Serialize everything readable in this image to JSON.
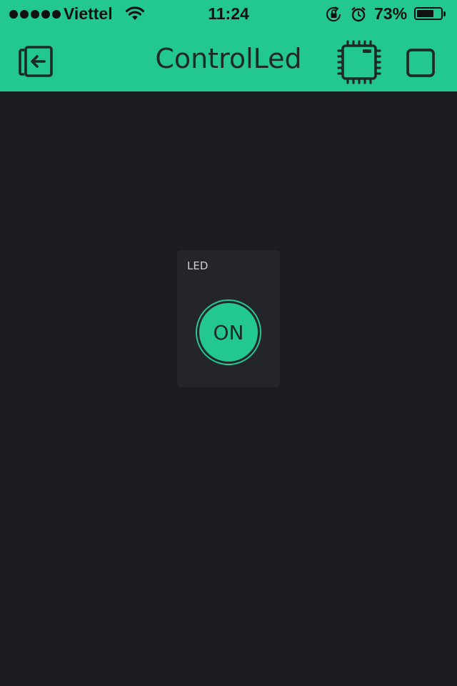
{
  "status_bar": {
    "carrier": "Viettel",
    "time": "11:24",
    "battery_percent": "73%",
    "battery_level": 0.73,
    "signal_bars": 5,
    "icons": [
      "wifi-icon",
      "rotation-lock-icon",
      "alarm-icon",
      "battery-icon"
    ]
  },
  "app_bar": {
    "title": "ControlLed",
    "left_icon": "exit-project-icon",
    "right_icons": [
      "hardware-device-icon",
      "stop-icon"
    ]
  },
  "widget": {
    "label": "LED",
    "button_label": "ON",
    "state": "on"
  },
  "colors": {
    "accent": "#23c890",
    "background": "#1b1c21",
    "widget_bg": "#24252a"
  }
}
